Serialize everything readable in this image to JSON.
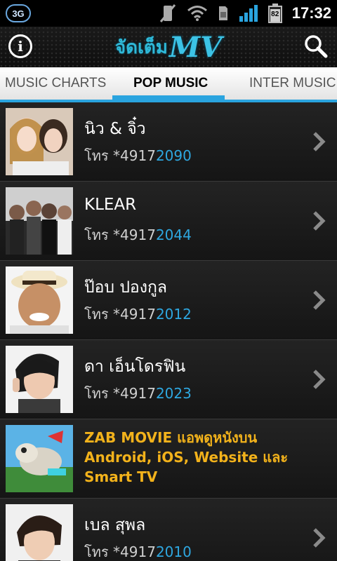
{
  "status_bar": {
    "network": "3G",
    "battery": "82",
    "time": "17:32"
  },
  "header": {
    "logo_thai": "จัดเต็ม",
    "logo_mv": "MV",
    "info_glyph": "i"
  },
  "tabs": [
    {
      "label": "MUSIC CHARTS",
      "active": false
    },
    {
      "label": "POP MUSIC",
      "active": true
    },
    {
      "label": "INTER MUSIC",
      "active": false
    }
  ],
  "list": [
    {
      "title": "นิว & จิ๋ว",
      "code_prefix": "โทร *4917",
      "code_suffix": "2090"
    },
    {
      "title": "KLEAR",
      "code_prefix": "โทร *4917",
      "code_suffix": "2044"
    },
    {
      "title": "ป๊อบ ปองกูล",
      "code_prefix": "โทร *4917",
      "code_suffix": "2012"
    },
    {
      "title": "ดา เอ็นโดรฟิน",
      "code_prefix": "โทร *4917",
      "code_suffix": "2023"
    },
    {
      "promo_lines": [
        "ZAB MOVIE แอพดูหนังบน",
        "Android, iOS, Website และ",
        "Smart TV"
      ]
    },
    {
      "title": "เบล สุพล",
      "code_prefix": "โทร *4917",
      "code_suffix": "2010"
    }
  ],
  "colors": {
    "accent": "#2aa4df",
    "promo": "#f2b21b",
    "logo": "#3cc3e6"
  },
  "icons": [
    "info-icon",
    "search-icon",
    "chevron-right-icon",
    "wifi-icon",
    "signal-icon",
    "battery-icon",
    "vibrate-off-icon",
    "sim-icon"
  ]
}
